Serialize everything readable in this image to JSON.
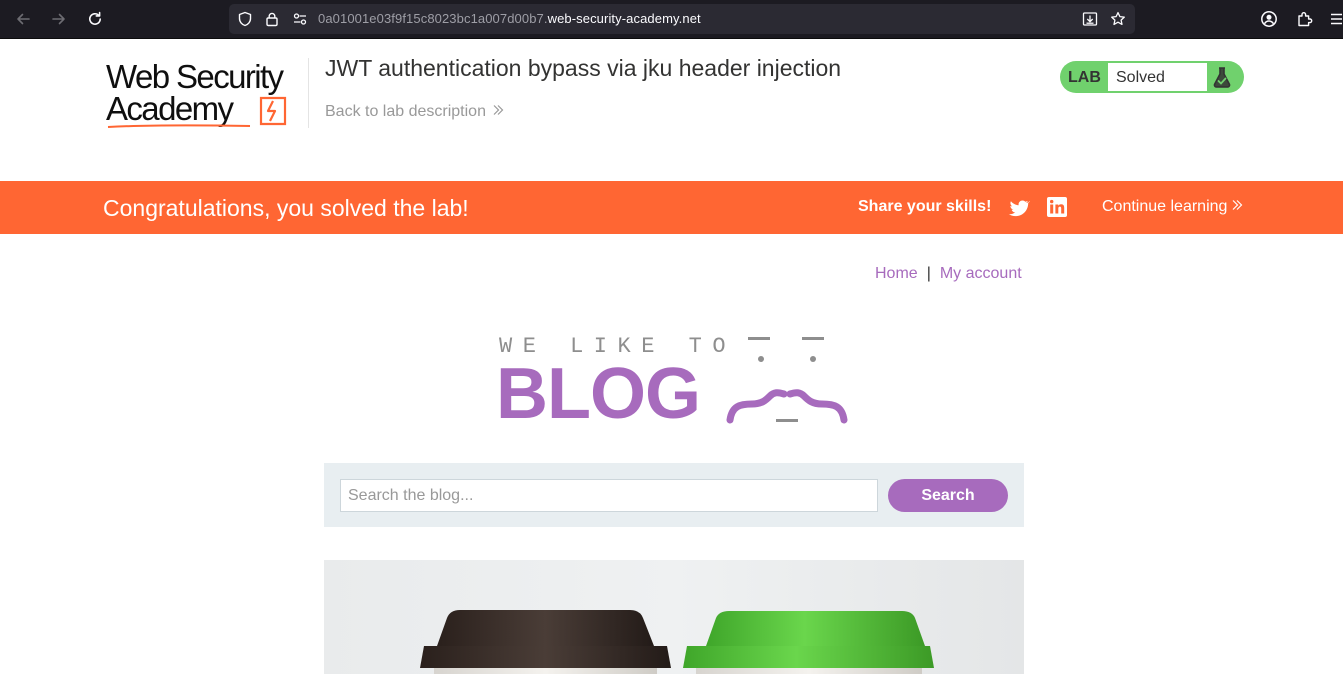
{
  "browser": {
    "url_prefix": "0a01001e03f9f15c8023bc1a007d00b7.",
    "url_domain": "web-security-academy.net",
    "icons": [
      "back-arrow-icon",
      "forward-arrow-icon",
      "reload-icon",
      "shield-icon",
      "lock-icon",
      "permissions-icon",
      "download-icon",
      "star-icon",
      "account-icon",
      "extensions-icon",
      "menu-icon"
    ]
  },
  "header": {
    "logo_line1": "Web Security",
    "logo_line2": "Academy",
    "lab_title": "JWT authentication bypass via jku header injection",
    "back_link": "Back to lab description",
    "lab_badge_label": "LAB",
    "lab_status": "Solved"
  },
  "banner": {
    "message": "Congratulations, you solved the lab!",
    "share_text": "Share your skills!",
    "continue_label": "Continue learning"
  },
  "nav": {
    "home": "Home",
    "separator": "|",
    "account": "My account"
  },
  "blog_logo": {
    "tagline": "WE LIKE TO",
    "word": "BLOG"
  },
  "search": {
    "placeholder": "Search the blog...",
    "button": "Search"
  },
  "colors": {
    "brand_orange": "#ff6633",
    "accent_purple": "#a76bbd",
    "solved_green": "#70d16d",
    "browser_bg": "#1c1b22"
  }
}
